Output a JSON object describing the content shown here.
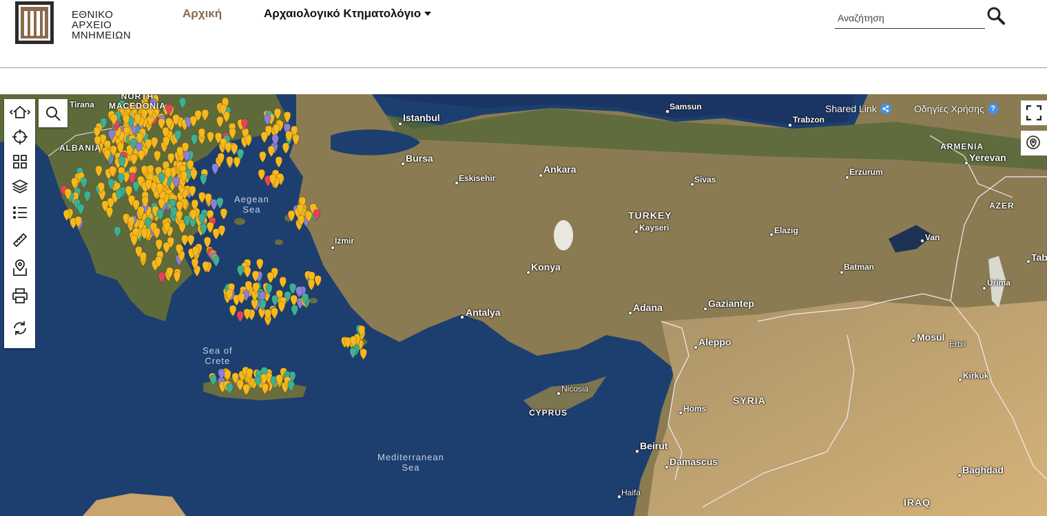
{
  "header": {
    "logo_lines": [
      "ΕΘΝΙΚΟ",
      "ΑΡΧΕΙΟ",
      "ΜΝΗΜΕΙΩΝ"
    ],
    "nav_home": "Αρχική",
    "nav_cadastre": "Αρχαιολογικό Κτηματολόγιο",
    "search_placeholder": "Αναζήτηση"
  },
  "map": {
    "shared_link": "Shared Link",
    "user_guide": "Οδηγίες Χρήσης",
    "help_glyph": "?",
    "labels": {
      "tirana": "Tirana",
      "north_macedonia": "NORTH\nMACEDONIA",
      "albania": "ALBANIA",
      "istanbul": "Istanbul",
      "bursa": "Bursa",
      "eskisehir": "Eskisehir",
      "ankara": "Ankara",
      "samsun": "Samsun",
      "trabzon": "Trabzon",
      "erzurum": "Erzurum",
      "sivas": "Sivas",
      "armenia": "ARMENIA",
      "yerevan": "Yerevan",
      "azer": "AZER",
      "turkey": "TURKEY",
      "kayseri": "Kayseri",
      "elazig": "Elazig",
      "van": "Van",
      "tab": "Tab",
      "izmir": "Izmir",
      "konya": "Konya",
      "batman": "Batman",
      "urima": "Urima",
      "antalya": "Antalya",
      "adana": "Adana",
      "gaziantep": "Gaziantep",
      "aleppo": "Aleppo",
      "mosul": "Mosul",
      "erbil": "Erbil",
      "kirkuk": "Kirkuk",
      "nicosia": "Nicosia",
      "cyprus": "CYPRUS",
      "syria": "SYRIA",
      "homs": "Homs",
      "beirut": "Beirut",
      "damascus": "Damascus",
      "baghdad": "Baghdad",
      "haifa": "Haifa",
      "iraq": "IRAQ",
      "aegean_sea": "Aegean\nSea",
      "sea_of_crete": "Sea of\nCrete",
      "mediterranean_sea": "Mediterranean\nSea",
      "sea_left": "ea"
    },
    "marker_colors": {
      "yellow": "#f6b81c",
      "teal": "#3fae93",
      "purple": "#8b7fd6",
      "red": "#e2445b"
    },
    "colors": {
      "sea": "#1b3b6d",
      "land": "#8a7a52",
      "desert": "#c9a46c",
      "green": "#5c6b3a"
    }
  }
}
